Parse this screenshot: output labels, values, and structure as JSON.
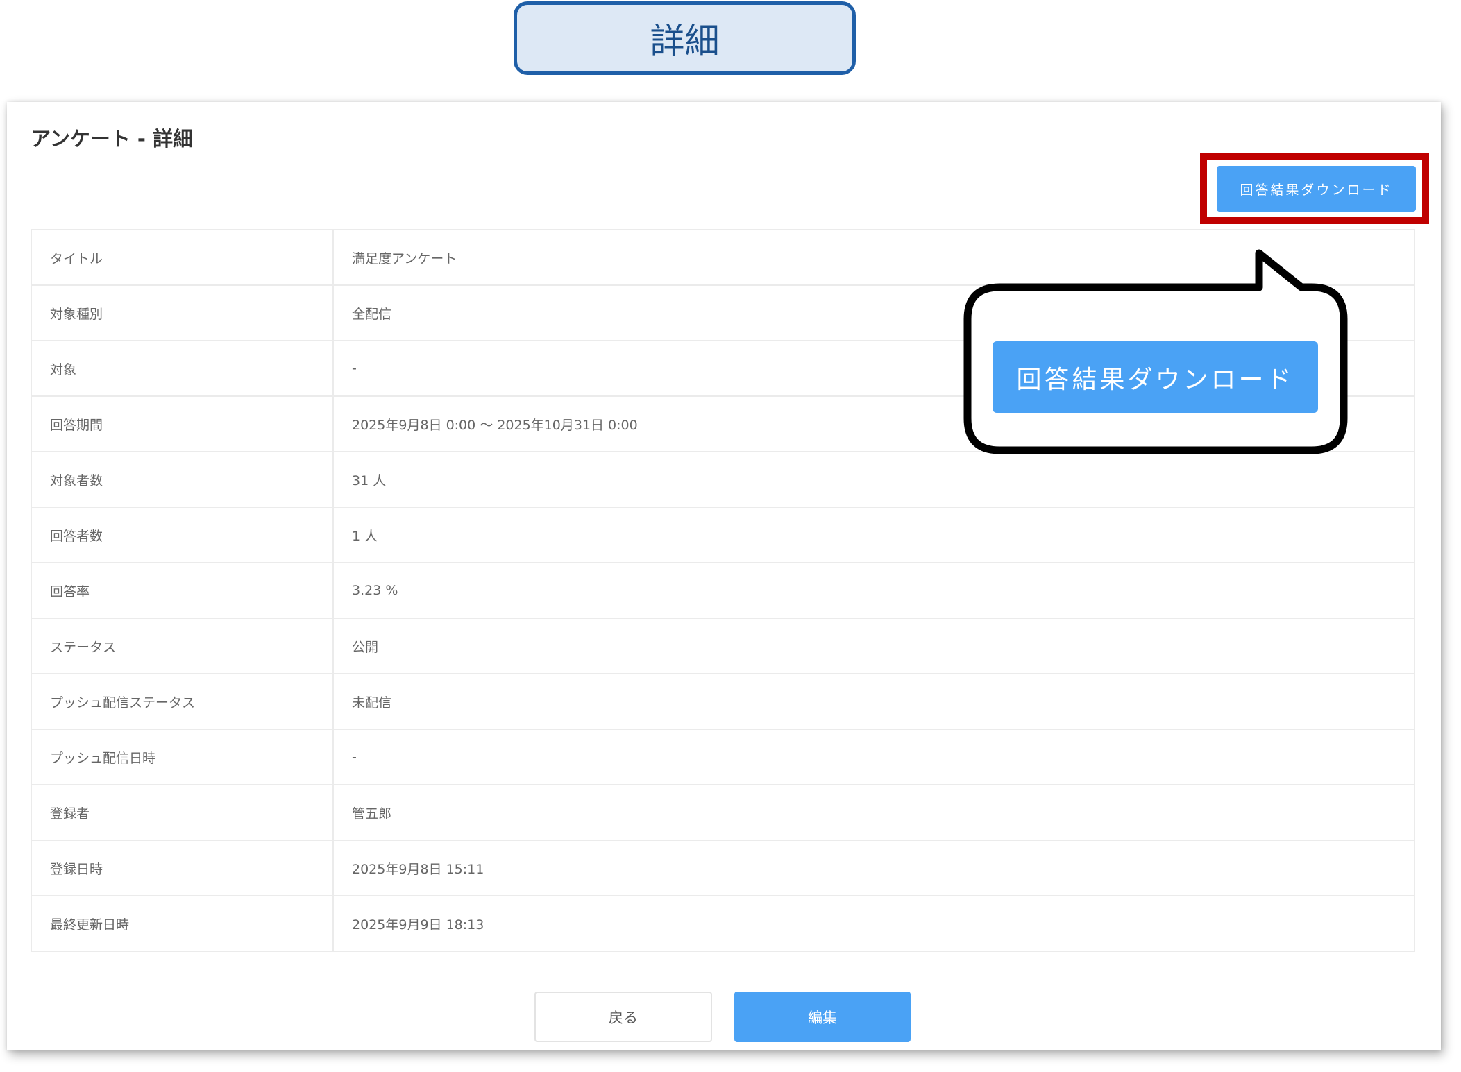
{
  "header_label": "詳細",
  "page_title": "アンケート - 詳細",
  "download_button": "回答結果ダウンロード",
  "callout_button": "回答結果ダウンロード",
  "rows": [
    {
      "label": "タイトル",
      "value": "満足度アンケート"
    },
    {
      "label": "対象種別",
      "value": "全配信"
    },
    {
      "label": "対象",
      "value": "-"
    },
    {
      "label": "回答期間",
      "value": "2025年9月8日 0:00 ～ 2025年10月31日 0:00"
    },
    {
      "label": "対象者数",
      "value": "31 人"
    },
    {
      "label": "回答者数",
      "value": "1 人"
    },
    {
      "label": "回答率",
      "value": "3.23 %"
    },
    {
      "label": "ステータス",
      "value": "公開"
    },
    {
      "label": "プッシュ配信ステータス",
      "value": "未配信"
    },
    {
      "label": "プッシュ配信日時",
      "value": "-"
    },
    {
      "label": "登録者",
      "value": "管五郎"
    },
    {
      "label": "登録日時",
      "value": "2025年9月8日 15:11"
    },
    {
      "label": "最終更新日時",
      "value": "2025年9月9日 18:13"
    }
  ],
  "footer": {
    "back_label": "戻る",
    "edit_label": "編集"
  },
  "colors": {
    "primary": "#4aa2f5",
    "highlight": "#c00000",
    "header_border": "#1f5fa8",
    "header_bg": "#dde8f5"
  }
}
